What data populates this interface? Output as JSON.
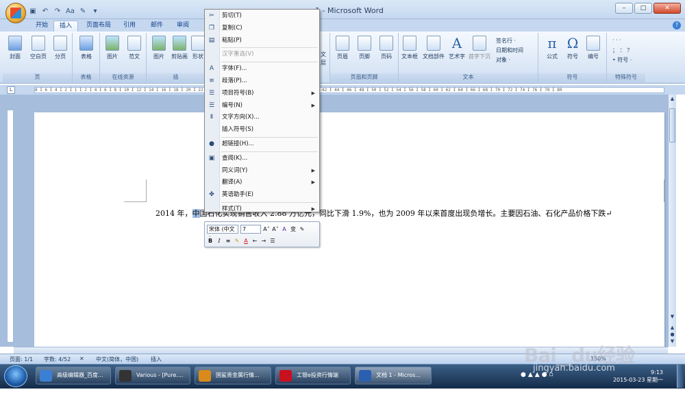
{
  "window": {
    "title": "1 - Microsoft Word"
  },
  "qat": {
    "items": [
      "↶",
      "↷",
      "Aa",
      "✎",
      "▾"
    ]
  },
  "tabs": [
    "开始",
    "插入",
    "页面布局",
    "引用",
    "邮件",
    "审阅"
  ],
  "active_tab": "插入",
  "ribbon": {
    "page_group": {
      "label": "页",
      "buttons": [
        "封面",
        "空白页",
        "分页"
      ]
    },
    "table_group": {
      "label": "表格",
      "buttons": [
        "表格"
      ]
    },
    "online_group": {
      "label": "在线资源",
      "buttons": [
        "图片",
        "范文"
      ]
    },
    "illus_group": {
      "label": "插",
      "buttons": [
        "图片",
        "剪贴画",
        "形状"
      ]
    },
    "link_group": {
      "buttons": [
        "文",
        "层"
      ]
    },
    "header_group": {
      "label": "页眉和页脚",
      "buttons": [
        "页眉",
        "页脚",
        "页码"
      ]
    },
    "text_group": {
      "label": "文本",
      "buttons": [
        "文本框",
        "文档部件",
        "艺术字",
        "首字下沉"
      ],
      "small": [
        "签名行 ·",
        "日期和时间",
        "对象 ·"
      ]
    },
    "symbol_group": {
      "label": "符号",
      "buttons": [
        "公式",
        "符号",
        "编号"
      ]
    },
    "special_group": {
      "label": "特殊符号",
      "small": [
        "· · ·",
        "； ： ？",
        "• 符号 ·"
      ]
    }
  },
  "ruler": {
    "text": "8 I 6 I 4 I 2 I 1 I 2 I 4 I 6 I 8 I 10 I 12 I 14 I 16 I 18 I 20 I 22 I 24 I 26 I 28 I 30 I 32 I 34 I 36 I 38 I 40 I 42 I 44 I 46 I 48 I 50 I 52 I 54 I 56 I 58 I 60 I 62 I 64 I 66 I 68 I 70 I 72 I 74 I 76 I 78 I 80"
  },
  "document": {
    "before": "2014 年，",
    "selected": "中",
    "hidden": "国石化实现销售收入 2.88 万亿",
    "after": "元，同比下滑 1.9%，也为 2009 年以来首度出现负增长。主要因石油、石化产品价格下跌↵"
  },
  "context_menu": [
    {
      "label": "剪切(T)",
      "icon": "scissors-icon",
      "glyph": "✂"
    },
    {
      "label": "复制(C)",
      "icon": "copy-icon",
      "glyph": "❐"
    },
    {
      "label": "粘贴(P)",
      "icon": "paste-icon",
      "glyph": "▤"
    },
    {
      "label": "汉字重选(V)",
      "icon": "",
      "glyph": "",
      "disabled": true
    },
    {
      "label": "字体(F)...",
      "icon": "font-icon",
      "glyph": "A"
    },
    {
      "label": "段落(P)...",
      "icon": "paragraph-icon",
      "glyph": "≡"
    },
    {
      "label": "项目符号(B)",
      "icon": "bullets-icon",
      "glyph": "☰",
      "submenu": true
    },
    {
      "label": "编号(N)",
      "icon": "numbering-icon",
      "glyph": "☰",
      "submenu": true
    },
    {
      "label": "文字方向(X)...",
      "icon": "text-direction-icon",
      "glyph": "Ⅱ"
    },
    {
      "label": "插入符号(S)",
      "icon": "",
      "glyph": ""
    },
    {
      "label": "超链接(H)...",
      "icon": "hyperlink-icon",
      "glyph": "●"
    },
    {
      "label": "查阅(K)...",
      "icon": "lookup-icon",
      "glyph": "▣"
    },
    {
      "label": "同义词(Y)",
      "icon": "",
      "glyph": "",
      "submenu": true
    },
    {
      "label": "翻译(A)",
      "icon": "",
      "glyph": "",
      "submenu": true
    },
    {
      "label": "英语助手(E)",
      "icon": "english-assistant-icon",
      "glyph": "✤"
    },
    {
      "label": "样式(T)",
      "icon": "",
      "glyph": "",
      "submenu": true
    }
  ],
  "mini_toolbar": {
    "font": "宋体 (中文 ·",
    "size": "7",
    "row1_icons": [
      "A˄",
      "A˅",
      "A",
      "变",
      "✎"
    ],
    "row2_icons": [
      "B",
      "I",
      "≡",
      "✎",
      "A",
      "←",
      "→",
      "☰"
    ]
  },
  "statusbar": {
    "page": "页面: 1/1",
    "words": "字数: 4/52",
    "lang": "中文(简体，中国)",
    "mode": "插入",
    "zoom": "150%"
  },
  "taskbar": {
    "tasks": [
      {
        "label": "高级编辑器_百度...",
        "color": "#3b7fd4"
      },
      {
        "label": "Various - [Pure....",
        "color": "#333333"
      },
      {
        "label": "国鲨贵金属行情...",
        "color": "#d88a1a"
      },
      {
        "label": "工银e投资行情端",
        "color": "#c8101e"
      },
      {
        "label": "文档 1 - Micros...",
        "color": "#2b5fb0"
      }
    ],
    "clock_time": "9:13",
    "clock_date": "2015-03-23 星期一"
  },
  "watermark": {
    "logo": "Bai‿du经验",
    "url": "jingyan.baidu.com"
  }
}
